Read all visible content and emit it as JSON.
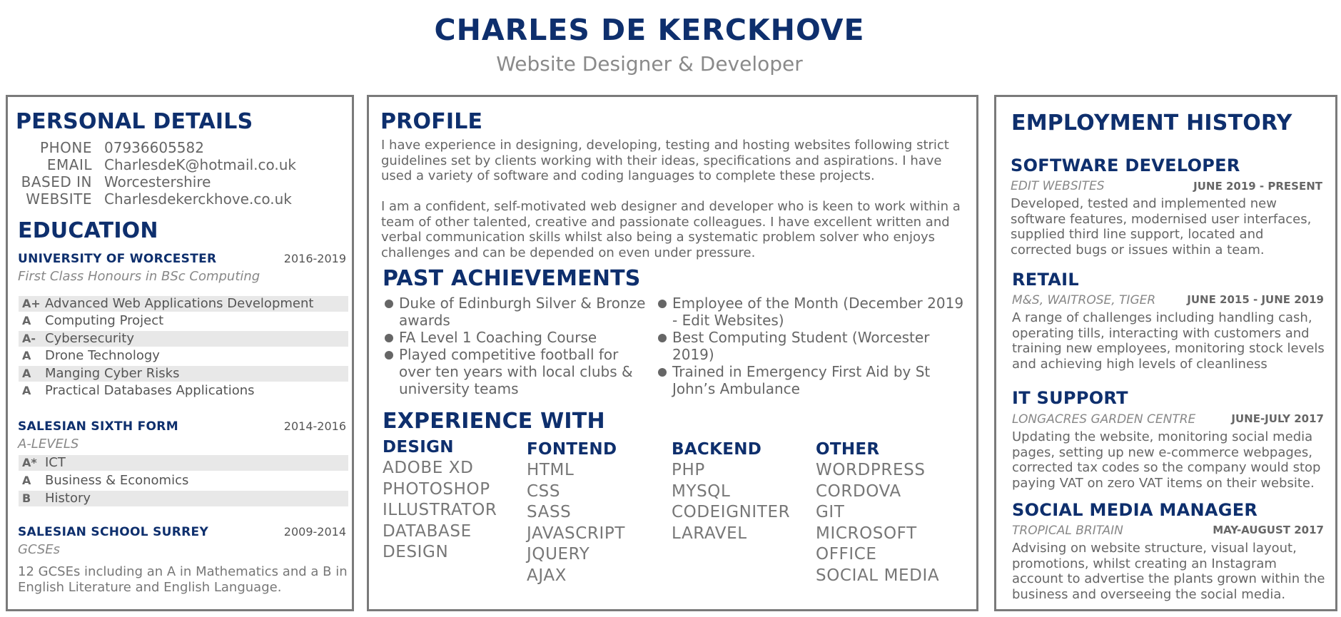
{
  "header": {
    "name": "CHARLES DE KERCKHOVE",
    "subtitle": "Website Designer & Developer"
  },
  "personal": {
    "heading": "PERSONAL DETAILS",
    "rows": [
      {
        "label": "PHONE",
        "value": "07936605582"
      },
      {
        "label": "EMAIL",
        "value": "CharlesdeK@hotmail.co.uk"
      },
      {
        "label": "BASED IN",
        "value": "Worcestershire"
      },
      {
        "label": "WEBSITE",
        "value": "Charlesdekerckhove.co.uk"
      }
    ]
  },
  "education": {
    "heading": "EDUCATION",
    "uni": {
      "title": "UNIVERSITY OF WORCESTER",
      "dates": "2016-2019",
      "subtitle": "First Class Honours in BSc Computing",
      "modules": [
        {
          "grade": "A+",
          "name": "Advanced Web Applications Development"
        },
        {
          "grade": "A",
          "name": "Computing Project"
        },
        {
          "grade": "A-",
          "name": "Cybersecurity"
        },
        {
          "grade": "A",
          "name": "Drone Technology"
        },
        {
          "grade": "A",
          "name": "Manging Cyber Risks"
        },
        {
          "grade": "A",
          "name": "Practical Databases Applications"
        }
      ]
    },
    "sixth": {
      "title": "SALESIAN SIXTH FORM",
      "dates": "2014-2016",
      "subtitle": "A-LEVELS",
      "modules": [
        {
          "grade": "A*",
          "name": "ICT"
        },
        {
          "grade": "A",
          "name": "Business & Economics"
        },
        {
          "grade": "B",
          "name": "History"
        }
      ]
    },
    "school": {
      "title": "SALESIAN SCHOOL SURREY",
      "dates": "2009-2014",
      "subtitle": "GCSEs",
      "text": "12 GCSEs including an A in Mathematics and a B in English Literature and English Language."
    }
  },
  "profile": {
    "heading": "PROFILE",
    "p1": "I have experience in designing, developing, testing and hosting websites following strict guidelines set by clients working with their ideas, specifications and aspirations. I have used a variety of software and coding languages to complete these projects.",
    "p2": "I am a confident, self-motivated web designer and developer who is keen to work within a team of other talented, creative and passionate colleagues. I have excellent written and verbal communication skills whilst also being a systematic problem solver who enjoys challenges and can be depended on even under pressure."
  },
  "achievements": {
    "heading": "PAST ACHIEVEMENTS",
    "left": [
      "Duke of Edinburgh Silver & Bronze awards",
      "FA Level 1 Coaching Course",
      "Played competitive football for over ten years with local clubs & university teams"
    ],
    "right": [
      "Employee of the Month (December 2019 - Edit Websites)",
      "Best Computing Student (Worcester 2019)",
      "Trained in Emergency First Aid by St John’s Ambulance"
    ]
  },
  "experience": {
    "heading": "EXPERIENCE WITH",
    "columns": [
      {
        "title": "DESIGN",
        "items": [
          "ADOBE XD",
          "PHOTOSHOP",
          "ILLUSTRATOR",
          "DATABASE",
          "DESIGN"
        ]
      },
      {
        "title": "FONTEND",
        "items": [
          "HTML",
          "CSS",
          "SASS",
          "JAVASCRIPT",
          "JQUERY",
          "AJAX"
        ]
      },
      {
        "title": "BACKEND",
        "items": [
          "PHP",
          "MYSQL",
          "CODEIGNITER",
          "LARAVEL"
        ]
      },
      {
        "title": "OTHER",
        "items": [
          "WORDPRESS",
          "CORDOVA",
          "GIT",
          "MICROSOFT",
          "OFFICE",
          "SOCIAL MEDIA"
        ]
      }
    ]
  },
  "employment": {
    "heading": "EMPLOYMENT HISTORY",
    "jobs": [
      {
        "title": "SOFTWARE DEVELOPER",
        "company": "EDIT WEBSITES",
        "dates": "JUNE 2019 - PRESENT",
        "desc": "Developed, tested and implemented new software features, modernised user interfaces, supplied third line support, located and corrected bugs or issues within a team."
      },
      {
        "title": "RETAIL",
        "company": "M&S, WAITROSE, TIGER",
        "dates": "JUNE 2015 - JUNE 2019",
        "desc": "A range of challenges including handling cash, operating tills, interacting with customers and training new employees, monitoring stock levels and achieving high levels of cleanliness"
      },
      {
        "title": "IT SUPPORT",
        "company": "LONGACRES GARDEN CENTRE",
        "dates": "JUNE-JULY 2017",
        "desc": "Updating the website, monitoring social media pages, setting up new e-commerce webpages, corrected tax codes so the company would stop paying VAT on zero VAT items on their website."
      },
      {
        "title": "SOCIAL MEDIA MANAGER",
        "company": "TROPICAL BRITAIN",
        "dates": "MAY-AUGUST 2017",
        "desc": "Advising on website structure, visual layout, promotions, whilst creating an Instagram account to advertise the plants grown within the business and overseeing the social media."
      }
    ]
  },
  "colors": {
    "heading": "#0e2f6d",
    "border": "#7a7a7a",
    "shade": "#e8e8e8"
  }
}
